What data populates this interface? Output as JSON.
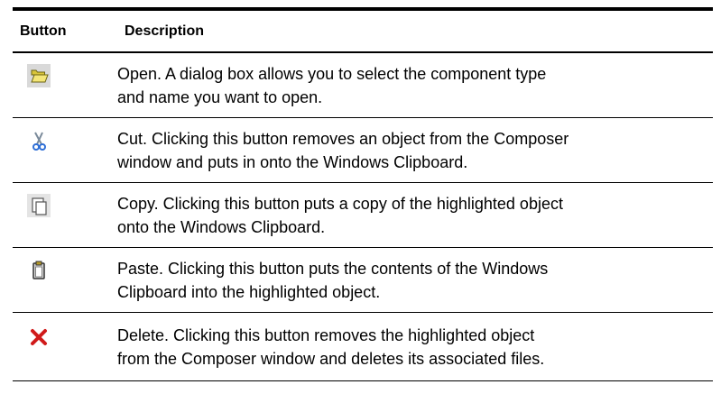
{
  "header": {
    "col_button": "Button",
    "col_description": "Description"
  },
  "rows": [
    {
      "icon": "open-folder-icon",
      "line1": "Open. A dialog box allows you to select the component type",
      "line2": "and name you want to open."
    },
    {
      "icon": "scissors-cut-icon",
      "line1": "Cut. Clicking this button removes an object from the Composer",
      "line2": "window and puts in onto the Windows Clipboard."
    },
    {
      "icon": "copy-icon",
      "line1": "Copy. Clicking this button puts a copy of the highlighted object",
      "line2": "onto the Windows Clipboard."
    },
    {
      "icon": "paste-clipboard-icon",
      "line1": "Paste. Clicking this button puts the contents of the Windows",
      "line2": "Clipboard into the highlighted object."
    },
    {
      "icon": "delete-x-icon",
      "line1": "Delete. Clicking this button removes the highlighted object",
      "line2": "from the Composer window and deletes its associated files."
    }
  ]
}
